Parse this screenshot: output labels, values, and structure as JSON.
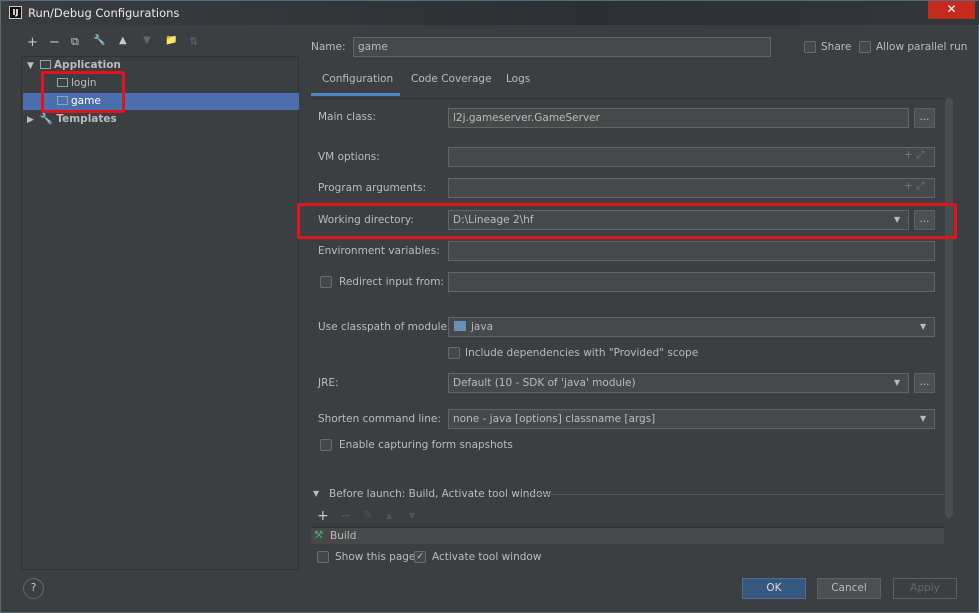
{
  "window": {
    "title": "Run/Debug Configurations",
    "close": "✕"
  },
  "toolbar": {
    "add": "+",
    "remove": "−",
    "copy": "⧉",
    "edit": "🔧",
    "up": "▲",
    "down": "▼",
    "folder": "📁",
    "sort": "⇅"
  },
  "tree": {
    "application": "Application",
    "items": [
      {
        "label": "login"
      },
      {
        "label": "game",
        "selected": true
      }
    ],
    "templates": "Templates"
  },
  "name": {
    "label": "Name:",
    "value": "game"
  },
  "share": {
    "label": "Share",
    "checked": false
  },
  "parallel": {
    "label": "Allow parallel run",
    "checked": false
  },
  "tabs": [
    {
      "label": "Configuration",
      "active": true
    },
    {
      "label": "Code Coverage"
    },
    {
      "label": "Logs"
    }
  ],
  "form": {
    "main_class": {
      "label": "Main class:",
      "value": "l2j.gameserver.GameServer",
      "button": "..."
    },
    "vm_options": {
      "label": "VM options:",
      "value": ""
    },
    "program_arguments": {
      "label": "Program arguments:",
      "value": ""
    },
    "working_directory": {
      "label": "Working directory:",
      "value": "D:\\Lineage 2\\hf",
      "button": "..."
    },
    "environment_variables": {
      "label": "Environment variables:",
      "value": ""
    },
    "redirect_input": {
      "label": "Redirect input from:",
      "value": "",
      "checked": false
    },
    "classpath_module": {
      "label": "Use classpath of module:",
      "value": "java"
    },
    "include_provided": {
      "label": "Include dependencies with \"Provided\" scope",
      "checked": false
    },
    "jre": {
      "label": "JRE:",
      "value": "Default (10 - SDK of 'java' module)",
      "button": "..."
    },
    "shorten_command": {
      "label": "Shorten command line:",
      "value": "none - java [options] classname [args]"
    },
    "form_snapshots": {
      "label": "Enable capturing form snapshots",
      "checked": false
    }
  },
  "before_launch": {
    "title": "Before launch: Build, Activate tool window",
    "tasks": [
      {
        "label": "Build"
      }
    ],
    "show_page": {
      "label": "Show this page",
      "checked": false
    },
    "activate_tool": {
      "label": "Activate tool window",
      "checked": true
    }
  },
  "buttons": {
    "help": "?",
    "ok": "OK",
    "cancel": "Cancel",
    "apply": "Apply"
  },
  "colors": {
    "accent": "#4b6eaf",
    "highlight": "#e0141b",
    "background": "#3c3f41"
  }
}
